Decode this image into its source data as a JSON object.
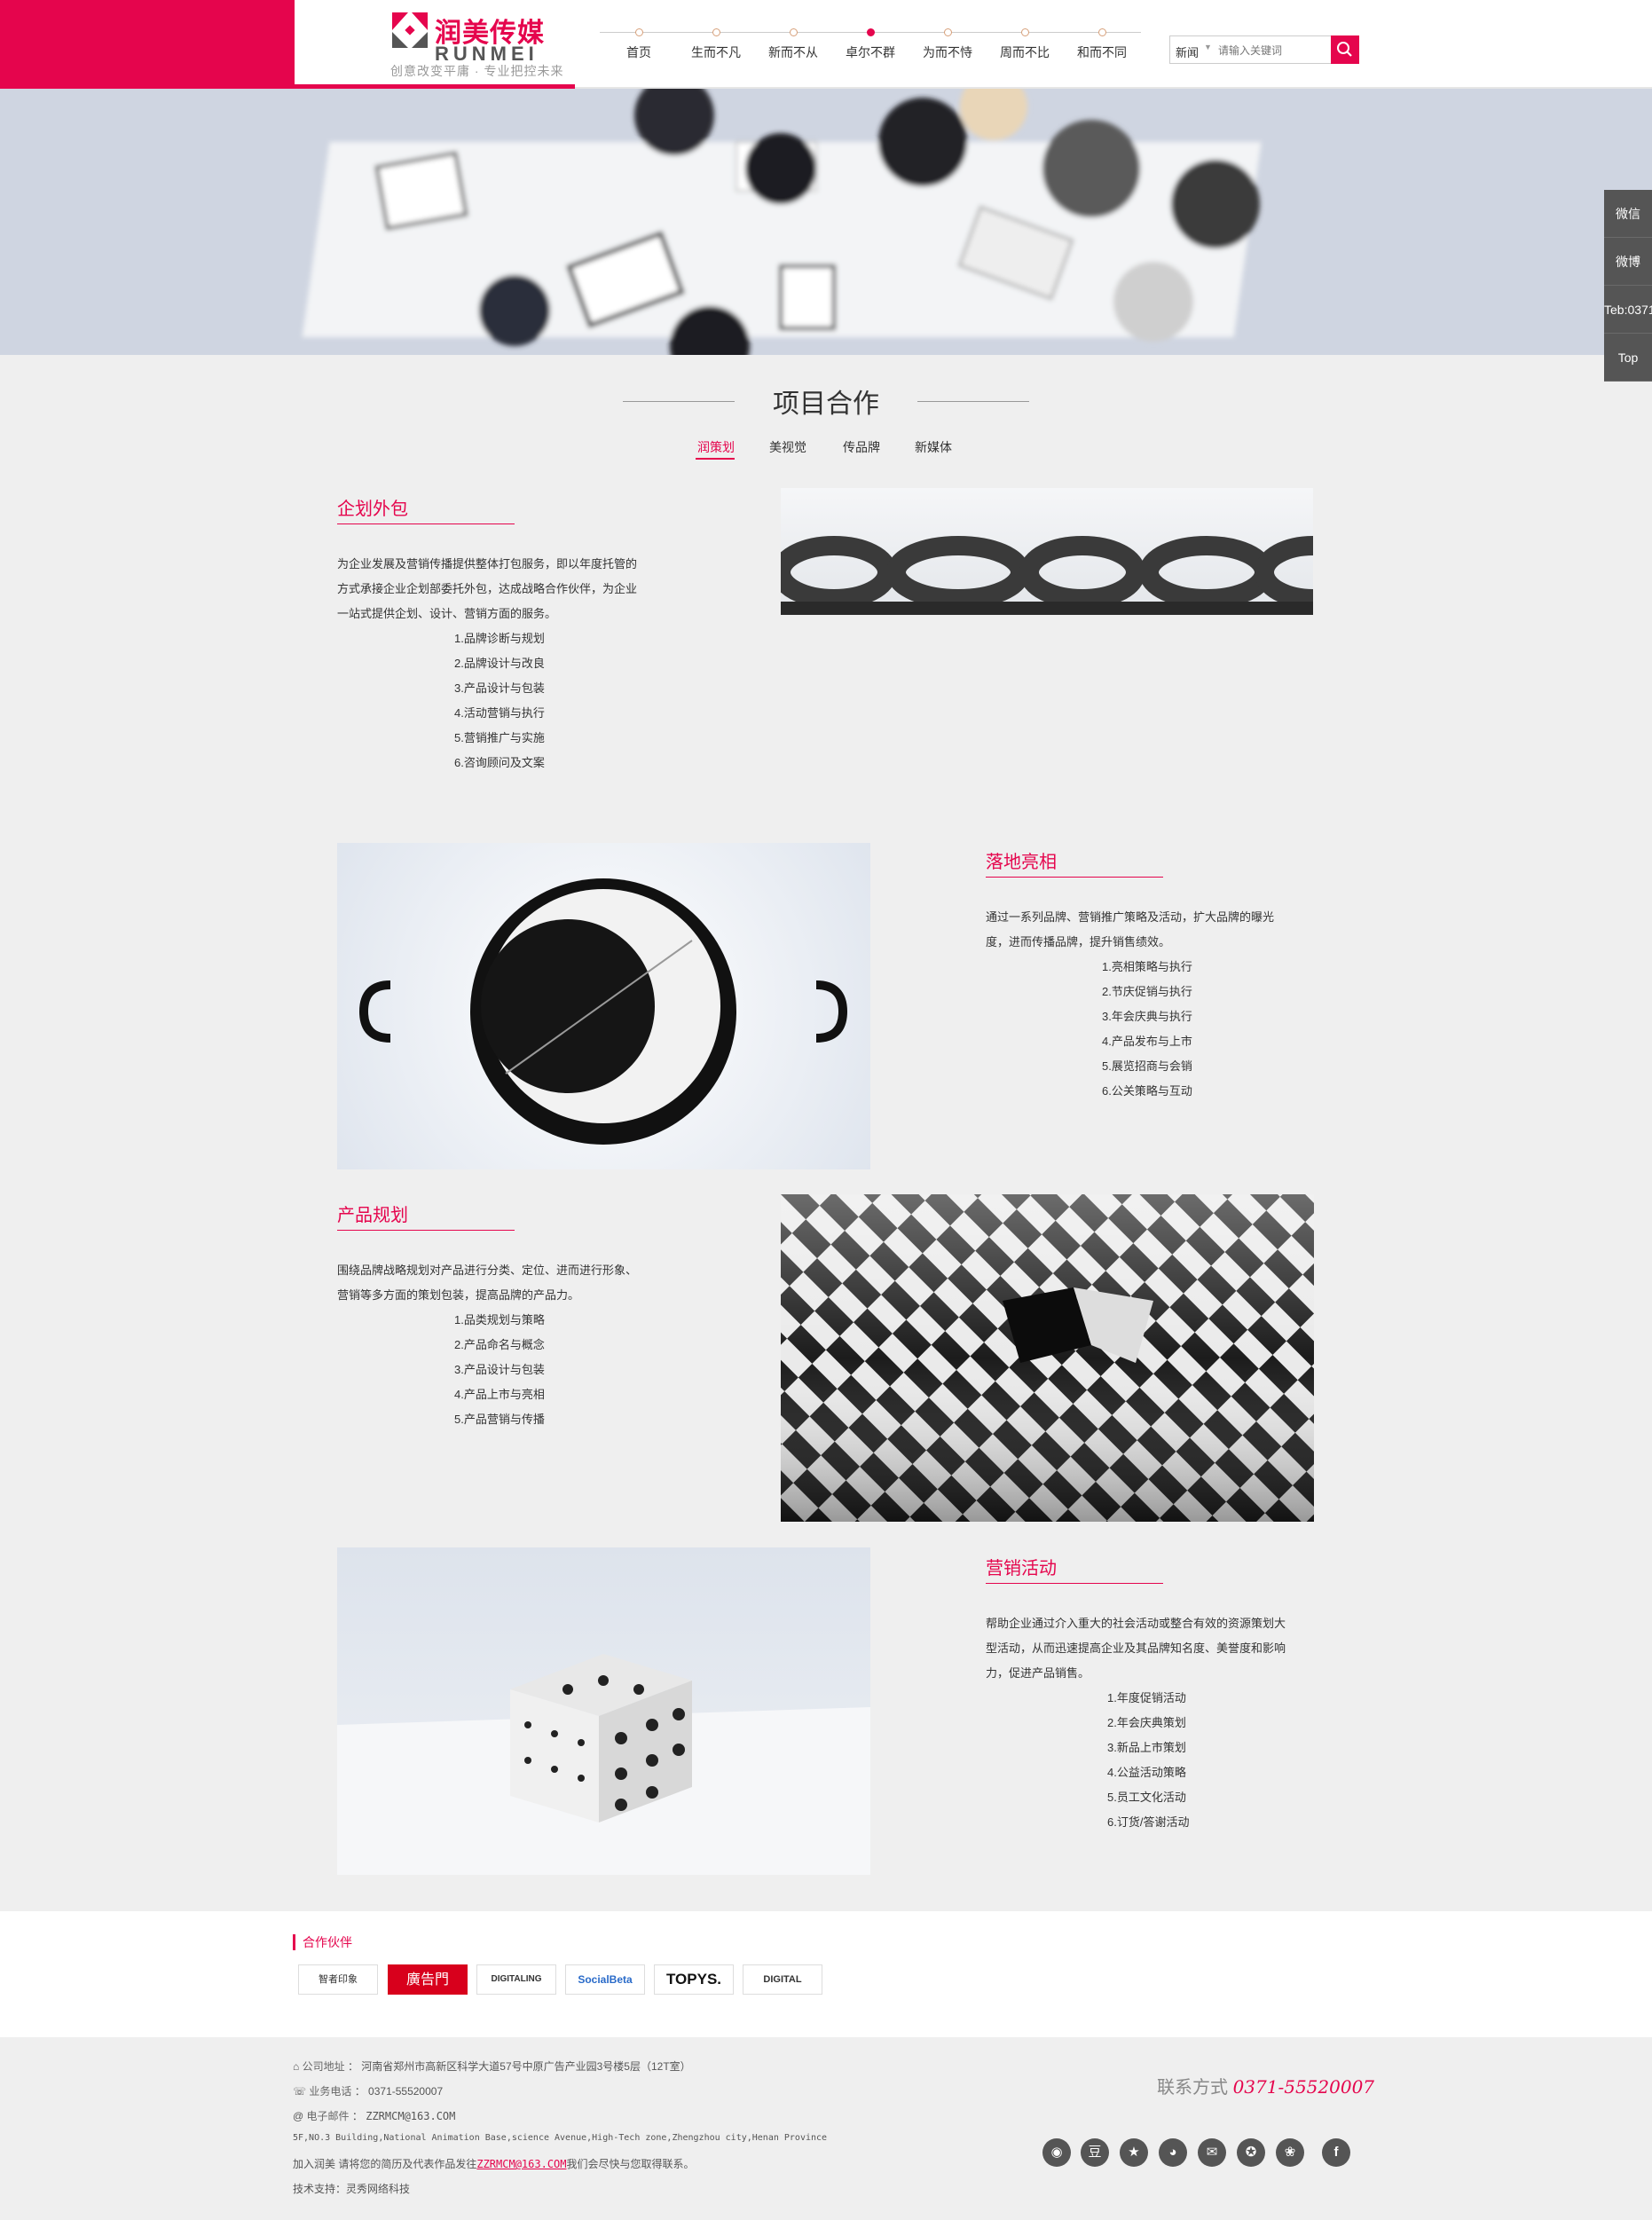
{
  "header": {
    "logo_cn": "润美传媒",
    "logo_en": "RUNMEI",
    "slogan": "创意改变平庸 · 专业把控未来",
    "nav": [
      {
        "label": "首页"
      },
      {
        "label": "生而不凡"
      },
      {
        "label": "新而不从"
      },
      {
        "label": "卓尔不群"
      },
      {
        "label": "为而不恃"
      },
      {
        "label": "周而不比"
      },
      {
        "label": "和而不同"
      }
    ],
    "nav_active_index": 3,
    "search": {
      "select": "新闻",
      "placeholder": "请输入关键词",
      "icon": "search-icon"
    }
  },
  "side_tools": [
    "微信",
    "微博",
    "Teb:0371",
    "Top"
  ],
  "section": {
    "title": "项目合作",
    "tabs": [
      "润策划",
      "美视觉",
      "传品牌",
      "新媒体"
    ],
    "active_tab": 0
  },
  "blocks": [
    {
      "title": "企划外包",
      "desc": [
        "为企业发展及营销传播提供整体打包服务，即以年度托管的",
        "方式承接企业企划部委托外包，达成战略合作伙伴，为企业",
        "一站式提供企划、设计、营销方面的服务。"
      ],
      "items": [
        "1.品牌诊断与规划",
        "2.品牌设计与改良",
        "3.产品设计与包装",
        "4.活动营销与执行",
        "5.营销推广与实施",
        "6.咨询顾问及文案"
      ]
    },
    {
      "title": "落地亮相",
      "desc": [
        "通过一系列品牌、营销推广策略及活动，扩大品牌的曝光",
        "度，进而传播品牌，提升销售绩效。"
      ],
      "items": [
        "1.亮相策略与执行",
        "2.节庆促销与执行",
        "3.年会庆典与执行",
        "4.产品发布与上市",
        "5.展览招商与会销",
        "6.公关策略与互动"
      ]
    },
    {
      "title": "产品规划",
      "desc": [
        "围绕品牌战略规划对产品进行分类、定位、进而进行形象、",
        "营销等多方面的策划包装，提高品牌的产品力。"
      ],
      "items": [
        "1.品类规划与策略",
        "2.产品命名与概念",
        "3.产品设计与包装",
        "4.产品上市与亮相",
        "5.产品营销与传播"
      ]
    },
    {
      "title": "营销活动",
      "desc": [
        "帮助企业通过介入重大的社会活动或整合有效的资源策划大",
        "型活动，从而迅速提高企业及其品牌知名度、美誉度和影响",
        "力，促进产品销售。"
      ],
      "items": [
        "1.年度促销活动",
        "2.年会庆典策划",
        "3.新品上市策划",
        "4.公益活动策略",
        "5.员工文化活动",
        "6.订货/答谢活动"
      ]
    }
  ],
  "partners": {
    "title": "合作伙伴",
    "logos": [
      "智者印象",
      "廣告門",
      "DIGITALING",
      "SocialBeta",
      "TOPYS.",
      "DIGITAL"
    ]
  },
  "footer": {
    "address_label": "公司地址",
    "address": "河南省郑州市高新区科学大道57号中原广告产业园3号楼5层（12T室）",
    "phone_label": "业务电话",
    "phone": "0371-55520007",
    "email_label": "电子邮件",
    "email": "ZZRMCM@163.COM",
    "address_en": "5F,NO.3 Building,National Animation Base,science Avenue,High-Tech zone,Zhengzhou city,Henan Province",
    "join_prefix": "加入润美 请将您的简历及代表作品发往",
    "join_email": "ZZRMCM@163.COM",
    "join_suffix": "我们会尽快与您取得联系。",
    "tech": "技术支持：灵秀网络科技",
    "contact_label": "联系方式",
    "contact_number": "0371-55520007",
    "social_icons": [
      "weibo-icon",
      "douban-icon",
      "star-icon",
      "qq-icon",
      "wechat-icon",
      "renren-icon",
      "baidu-icon",
      "facebook-icon"
    ]
  },
  "colors": {
    "accent": "#e5054d",
    "footer_bg": "#efefef",
    "side_bg": "#555555"
  }
}
